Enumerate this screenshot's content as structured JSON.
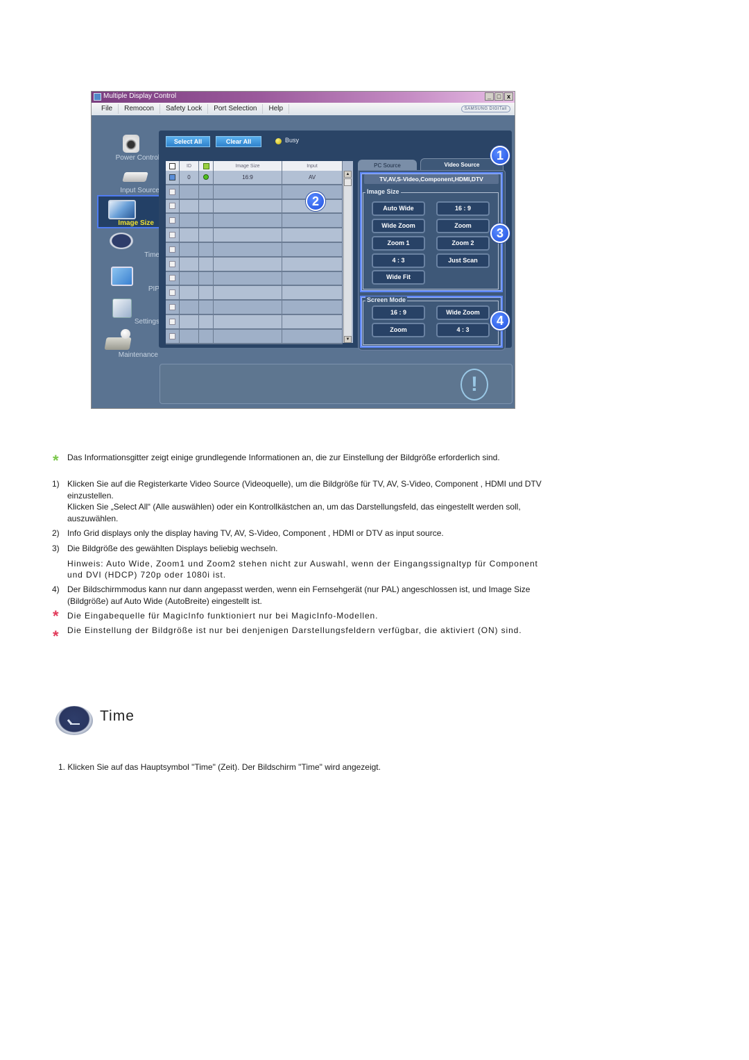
{
  "window": {
    "title": "Multiple Display Control",
    "controls": [
      "_",
      "□",
      "x"
    ],
    "menu": [
      "File",
      "Remocon",
      "Safety Lock",
      "Port Selection",
      "Help"
    ],
    "brand": "SAMSUNG DIGITall"
  },
  "nav": [
    {
      "label": "Power Control",
      "icon": "camera-power-icon",
      "selected": false
    },
    {
      "label": "Input Source",
      "icon": "input-device-icon",
      "selected": false
    },
    {
      "label": "Image Size",
      "icon": "monitor-resize-icon",
      "selected": true
    },
    {
      "label": "Time",
      "icon": "clock-icon",
      "selected": false
    },
    {
      "label": "PIP",
      "icon": "pip-screen-icon",
      "selected": false
    },
    {
      "label": "Settings",
      "icon": "settings-box-icon",
      "selected": false
    },
    {
      "label": "Maintenance",
      "icon": "maintenance-icon",
      "selected": false
    }
  ],
  "toolbar": {
    "select_all": "Select All",
    "clear_all": "Clear All",
    "busy": "Busy"
  },
  "grid": {
    "headers": [
      "",
      "ID",
      "",
      "Image Size",
      "Input"
    ],
    "rows": [
      {
        "checked": true,
        "id": "0",
        "status": "on",
        "image_size": "16:9",
        "input": "AV"
      },
      {
        "checked": false,
        "id": "",
        "status": "",
        "image_size": "",
        "input": ""
      },
      {
        "checked": false,
        "id": "",
        "status": "",
        "image_size": "",
        "input": ""
      },
      {
        "checked": false,
        "id": "",
        "status": "",
        "image_size": "",
        "input": ""
      },
      {
        "checked": false,
        "id": "",
        "status": "",
        "image_size": "",
        "input": ""
      },
      {
        "checked": false,
        "id": "",
        "status": "",
        "image_size": "",
        "input": ""
      },
      {
        "checked": false,
        "id": "",
        "status": "",
        "image_size": "",
        "input": ""
      },
      {
        "checked": false,
        "id": "",
        "status": "",
        "image_size": "",
        "input": ""
      },
      {
        "checked": false,
        "id": "",
        "status": "",
        "image_size": "",
        "input": ""
      },
      {
        "checked": false,
        "id": "",
        "status": "",
        "image_size": "",
        "input": ""
      },
      {
        "checked": false,
        "id": "",
        "status": "",
        "image_size": "",
        "input": ""
      },
      {
        "checked": false,
        "id": "",
        "status": "",
        "image_size": "",
        "input": ""
      }
    ]
  },
  "tabs": {
    "pc_source": "PC Source",
    "video_source": "Video Source",
    "active": "Video Source"
  },
  "source_label": "TV,AV,S-Video,Component,HDMI,DTV",
  "image_size": {
    "legend": "Image Size",
    "buttons": [
      "Auto Wide",
      "16 : 9",
      "Wide Zoom",
      "Zoom",
      "Zoom 1",
      "Zoom 2",
      "4 : 3",
      "Just Scan",
      "Wide Fit"
    ]
  },
  "screen_mode": {
    "legend": "Screen Mode",
    "buttons": [
      "16 : 9",
      "Wide Zoom",
      "Zoom",
      "4 : 3"
    ]
  },
  "callouts": [
    "1",
    "2",
    "3",
    "4"
  ],
  "colors": {
    "highlight": "#5c86f6",
    "star_green": "#7ac74a",
    "star_red": "#e23a5a",
    "selected_nav_text": "#f0e030"
  },
  "doc": {
    "note_info": "Das Informationsgitter zeigt einige grundlegende Informationen an, die zur Einstellung der Bildgröße erforderlich sind.",
    "steps": [
      {
        "num": "1)",
        "text": "Klicken Sie auf die Registerkarte Video Source (Videoquelle), um die Bildgröße für TV, AV, S-Video, Component , HDMI und DTV einzustellen.",
        "extra": "Klicken Sie „Select All“ (Alle auswählen) oder ein Kontrollkästchen an, um das Darstellungsfeld, das eingestellt werden soll, auszuwählen."
      },
      {
        "num": "2)",
        "text": "Info Grid displays only the display having TV, AV, S-Video, Component , HDMI or DTV as input source."
      },
      {
        "num": "3)",
        "text": "Die Bildgröße des gewählten Displays beliebig wechseln.",
        "extra": "Hinweis: Auto Wide, Zoom1 und Zoom2 stehen nicht zur Auswahl, wenn der Eingangssignaltyp für Component und DVI (HDCP) 720p oder 1080i ist."
      },
      {
        "num": "4)",
        "text": "Der Bildschirmmodus kann nur dann angepasst werden, wenn ein Fernsehgerät (nur PAL) angeschlossen ist, und Image Size (Bildgröße) auf Auto Wide (AutoBreite) eingestellt ist."
      }
    ],
    "note_magicinfo": "Die Eingabequelle für MagicInfo funktioniert nur bei MagicInfo-Modellen.",
    "note_on": "Die Einstellung der Bildgröße ist nur bei denjenigen Darstellungsfeldern verfügbar, die aktiviert (ON) sind.",
    "section_title": "Time",
    "section_step": "1.  Klicken Sie auf das Hauptsymbol \"Time\" (Zeit). Der Bildschirm \"Time\" wird angezeigt."
  }
}
